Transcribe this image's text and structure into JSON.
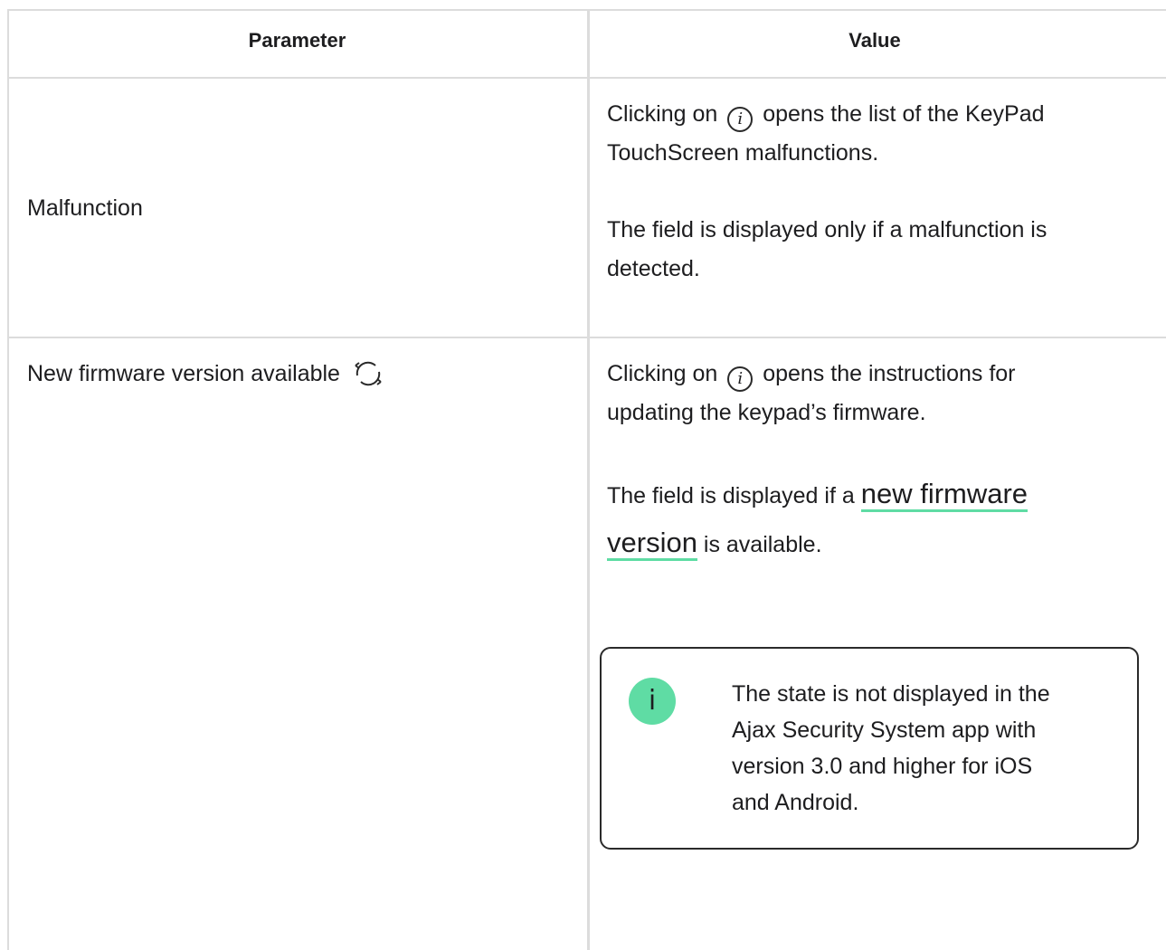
{
  "table": {
    "headers": {
      "parameter": "Parameter",
      "value": "Value"
    },
    "rows": [
      {
        "parameter": "Malfunction",
        "value_line1_prefix": "Clicking on",
        "value_line1_suffix": "opens the list of the KeyPad",
        "value_line2": "TouchScreen malfunctions.",
        "value_para2_line1": "The field is displayed only if a malfunction is",
        "value_para2_line2": "detected."
      },
      {
        "parameter": "New firmware version available",
        "parameter_icon": "refresh-icon",
        "value_line1_prefix": "Clicking on",
        "value_line1_suffix": "opens the instructions for",
        "value_line2": "updating the keypad’s firmware.",
        "value_para2_prefix": "The field is displayed if a",
        "value_para2_link_part1": "new firmware",
        "value_para2_link_part2": "version",
        "value_para2_suffix": "is available.",
        "note": {
          "icon": "info-icon",
          "line1": "The state is not displayed in the",
          "line2": "Ajax Security System app with",
          "line3": "version 3.0 and higher for iOS",
          "line4": "and Android."
        }
      }
    ]
  },
  "info_glyph": "i",
  "colors": {
    "accent": "#5fdca4",
    "border": "#dcdcdc",
    "text": "#1d1d1f"
  }
}
